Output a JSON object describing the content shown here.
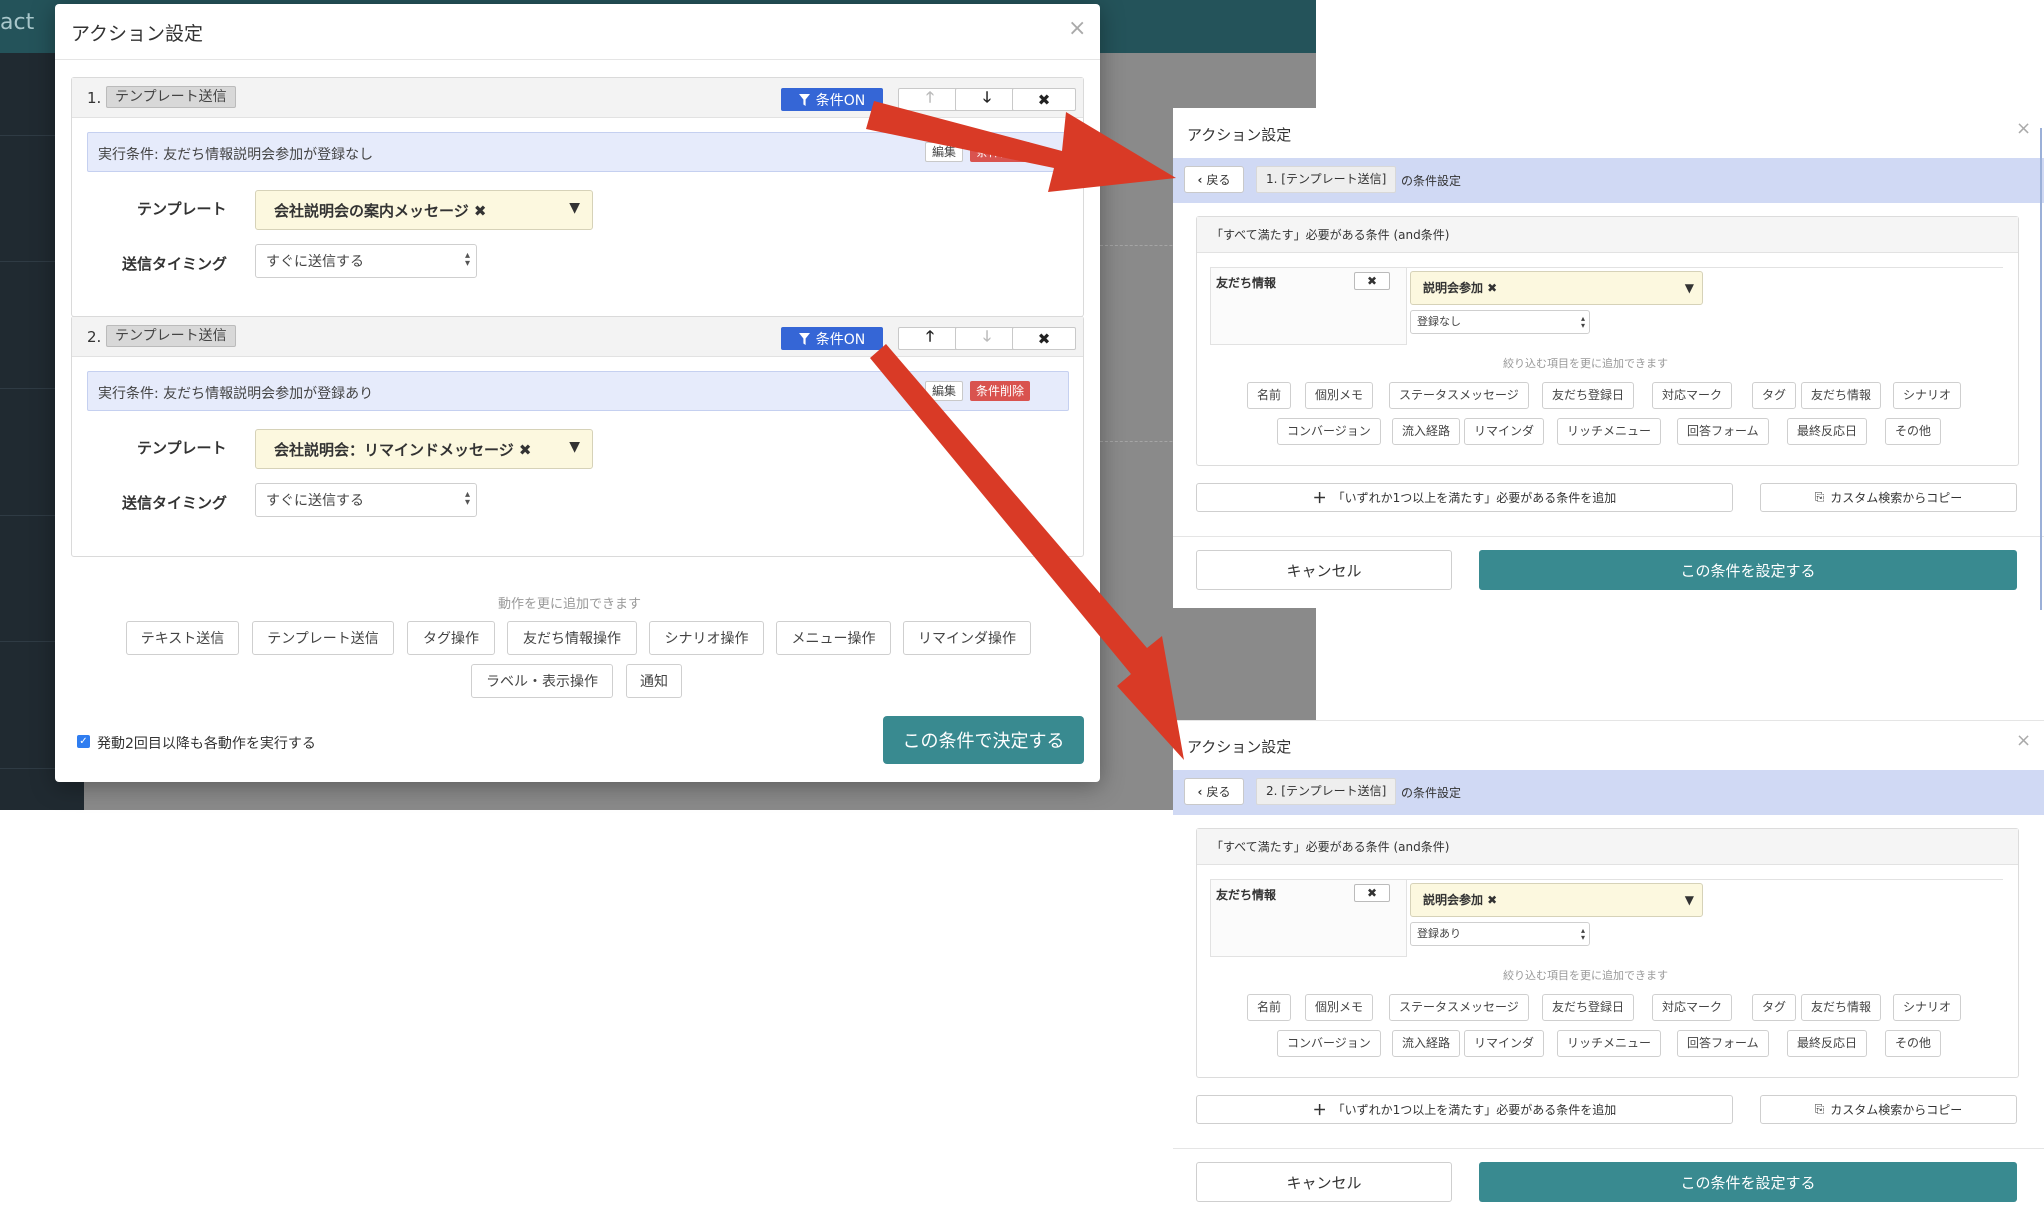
{
  "app": {
    "brand_fragment": "act"
  },
  "left_modal": {
    "title": "アクション設定",
    "close": "×",
    "actions": [
      {
        "number": "1.",
        "type": "テンプレート送信",
        "cond_on": "条件ON",
        "condition": "実行条件: 友だち情報説明会参加が登録なし",
        "edit": "編集",
        "delete": "条件削除",
        "template_label": "テンプレート",
        "template_value": "会社説明会の案内メッセージ ✖",
        "timing_label": "送信タイミング",
        "timing_value": "すぐに送信する"
      },
      {
        "number": "2.",
        "type": "テンプレート送信",
        "cond_on": "条件ON",
        "condition": "実行条件: 友だち情報説明会参加が登録あり",
        "edit": "編集",
        "delete": "条件削除",
        "template_label": "テンプレート",
        "template_value": "会社説明会：リマインドメッセージ ✖",
        "timing_label": "送信タイミング",
        "timing_value": "すぐに送信する"
      }
    ],
    "add_hint": "動作を更に追加できます",
    "add_buttons": [
      "テキスト送信",
      "テンプレート送信",
      "タグ操作",
      "友だち情報操作",
      "シナリオ操作",
      "メニュー操作",
      "リマインダ操作",
      "ラベル・表示操作",
      "通知"
    ],
    "repeat_label": "発動2回目以降も各動作を実行する",
    "submit": "この条件で決定する"
  },
  "right_modals": [
    {
      "title": "アクション設定",
      "close": "×",
      "back": "戻る",
      "crumb": "1. [テンプレート送信]",
      "crumb_suffix": "の条件設定",
      "and_header": "「すべて満たす」必要がある条件 (and条件)",
      "criterion_label": "友だち情報",
      "criterion_field": "説明会参加 ✖",
      "criterion_value": "登録なし",
      "more_hint": "絞り込む項目を更に追加できます",
      "chips": [
        "名前",
        "個別メモ",
        "ステータスメッセージ",
        "友だち登録日",
        "対応マーク",
        "タグ",
        "友だち情報",
        "シナリオ",
        "コンバージョン",
        "流入経路",
        "リマインダ",
        "リッチメニュー",
        "回答フォーム",
        "最終反応日",
        "その他"
      ],
      "or_add": "「いずれか1つ以上を満たす」必要がある条件を追加",
      "copy": "カスタム検索からコピー",
      "cancel": "キャンセル",
      "confirm": "この条件を設定する"
    },
    {
      "title": "アクション設定",
      "close": "×",
      "back": "戻る",
      "crumb": "2. [テンプレート送信]",
      "crumb_suffix": "の条件設定",
      "and_header": "「すべて満たす」必要がある条件 (and条件)",
      "criterion_label": "友だち情報",
      "criterion_field": "説明会参加 ✖",
      "criterion_value": "登録あり",
      "more_hint": "絞り込む項目を更に追加できます",
      "chips": [
        "名前",
        "個別メモ",
        "ステータスメッセージ",
        "友だち登録日",
        "対応マーク",
        "タグ",
        "友だち情報",
        "シナリオ",
        "コンバージョン",
        "流入経路",
        "リマインダ",
        "リッチメニュー",
        "回答フォーム",
        "最終反応日",
        "その他"
      ],
      "or_add": "「いずれか1つ以上を満たす」必要がある条件を追加",
      "copy": "カスタム検索からコピー",
      "cancel": "キャンセル",
      "confirm": "この条件を設定する"
    }
  ],
  "colors": {
    "teal": "#398a90",
    "cond_blue": "#3566d6",
    "danger": "#d9534f",
    "arrow": "#d93a26"
  }
}
